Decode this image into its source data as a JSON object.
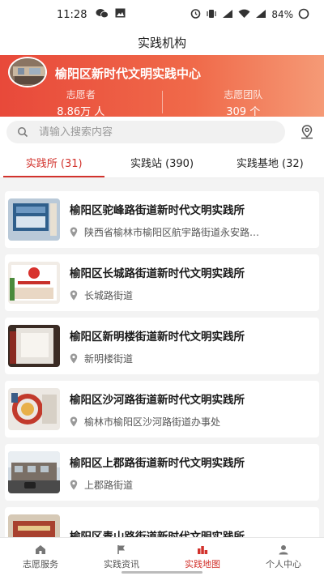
{
  "status_bar": {
    "time": "11:28",
    "battery": "84%"
  },
  "header": {
    "title": "实践机构"
  },
  "banner": {
    "center_name": "榆阳区新时代文明实践中心",
    "stats": [
      {
        "label": "志愿者",
        "value": "8.86万 人"
      },
      {
        "label": "志愿团队",
        "value": "309 个"
      }
    ]
  },
  "search": {
    "placeholder": "请输入搜索内容"
  },
  "tabs": [
    {
      "label": "实践所 (31)",
      "active": true
    },
    {
      "label": "实践站 (390)",
      "active": false
    },
    {
      "label": "实践基地 (32)",
      "active": false
    }
  ],
  "items": [
    {
      "title": "榆阳区驼峰路街道新时代文明实践所",
      "address": "陕西省榆林市榆阳区航宇路街道永安路…"
    },
    {
      "title": "榆阳区长城路街道新时代文明实践所",
      "address": "长城路街道"
    },
    {
      "title": "榆阳区新明楼街道新时代文明实践所",
      "address": "新明楼街道"
    },
    {
      "title": "榆阳区沙河路街道新时代文明实践所",
      "address": "榆林市榆阳区沙河路街道办事处"
    },
    {
      "title": "榆阳区上郡路街道新时代文明实践所",
      "address": "上郡路街道"
    },
    {
      "title": "榆阳区青山路街道新时代文明实践所",
      "address": ""
    }
  ],
  "bottom_nav": [
    {
      "label": "志愿服务",
      "icon": "home-icon",
      "active": false
    },
    {
      "label": "实践资讯",
      "icon": "flag-icon",
      "active": false
    },
    {
      "label": "实践地图",
      "icon": "map-icon",
      "active": true
    },
    {
      "label": "个人中心",
      "icon": "person-icon",
      "active": false
    }
  ],
  "colors": {
    "accent": "#d2322c",
    "banner_start": "#e8493a",
    "banner_end": "#f59a76"
  }
}
